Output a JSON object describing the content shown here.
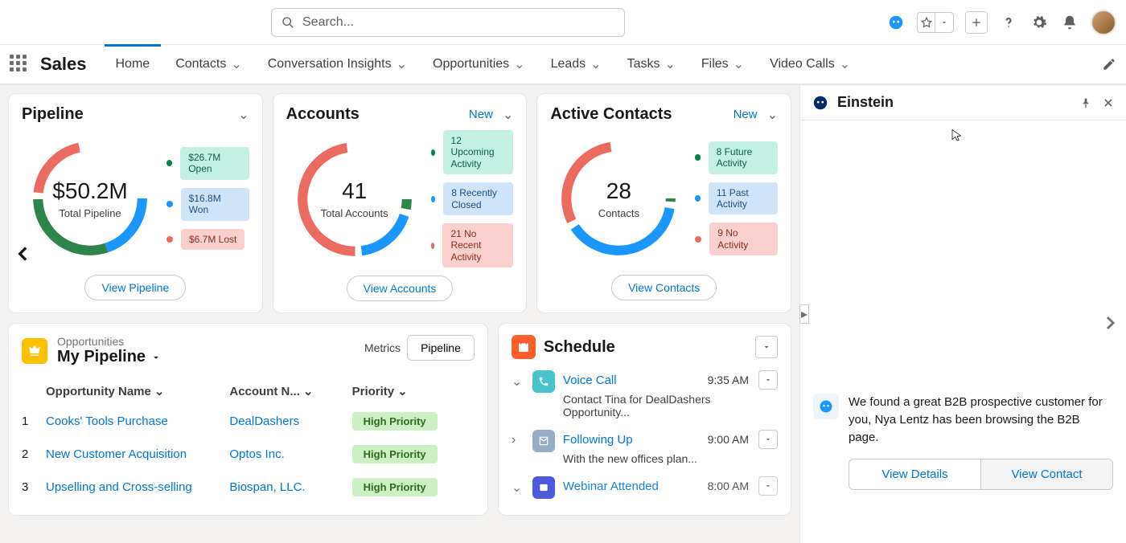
{
  "search": {
    "placeholder": "Search..."
  },
  "app_name": "Sales",
  "nav_tabs": [
    "Home",
    "Contacts",
    "Conversation Insights",
    "Opportunities",
    "Leads",
    "Tasks",
    "Files",
    "Video Calls"
  ],
  "active_tab": "Home",
  "pipeline_card": {
    "title": "Pipeline",
    "center_value": "$50.2M",
    "center_label": "Total Pipeline",
    "badges": [
      "$26.7M Open",
      "$16.8M Won",
      "$6.7M Lost"
    ],
    "button": "View Pipeline"
  },
  "accounts_card": {
    "title": "Accounts",
    "new": "New",
    "center_value": "41",
    "center_label": "Total Accounts",
    "badges": [
      "12 Upcoming Activity",
      "8 Recently Closed",
      "21 No Recent Activity"
    ],
    "button": "View Accounts"
  },
  "contacts_card": {
    "title": "Active Contacts",
    "new": "New",
    "center_value": "28",
    "center_label": "Contacts",
    "badges": [
      "8 Future Activity",
      "11 Past Activity",
      "9 No Activity"
    ],
    "button": "View Contacts"
  },
  "opportunities": {
    "super": "Opportunities",
    "title": "My Pipeline",
    "metrics": "Metrics",
    "pipeline": "Pipeline",
    "cols": [
      "Opportunity Name",
      "Account N...",
      "Priority"
    ],
    "rows": [
      {
        "n": "1",
        "name": "Cooks' Tools Purchase",
        "account": "DealDashers",
        "priority": "High Priority"
      },
      {
        "n": "2",
        "name": "New Customer Acquisition",
        "account": "Optos Inc.",
        "priority": "High Priority"
      },
      {
        "n": "3",
        "name": "Upselling and Cross-selling",
        "account": "Biospan, LLC.",
        "priority": "High Priority"
      }
    ]
  },
  "schedule": {
    "title": "Schedule",
    "items": [
      {
        "title": "Voice Call",
        "time": "9:35 AM",
        "desc": "Contact Tina for DealDashers Opportunity..."
      },
      {
        "title": "Following Up",
        "time": "9:00 AM",
        "desc": "With the new offices plan..."
      },
      {
        "title": "Webinar Attended",
        "time": "8:00 AM",
        "desc": ""
      }
    ]
  },
  "einstein": {
    "title": "Einstein",
    "message": "We found a great B2B prospective customer for you, Nya Lentz has been browsing the B2B page.",
    "btn1": "View Details",
    "btn2": "View Contact"
  }
}
